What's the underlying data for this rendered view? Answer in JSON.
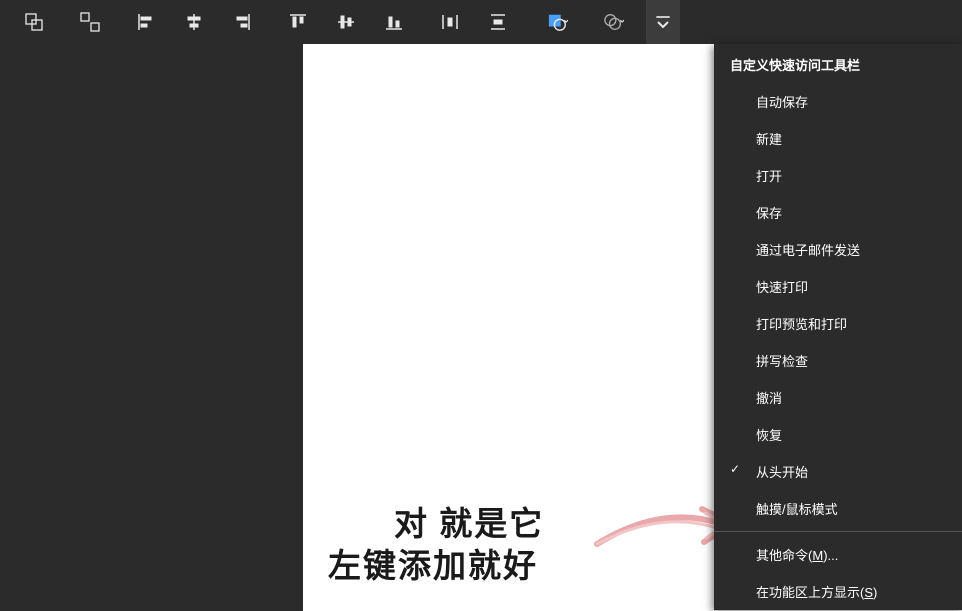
{
  "toolbar": {
    "icons": [
      "group-icon",
      "ungroup-icon",
      "align-left-icon",
      "align-center-h-icon",
      "align-right-icon",
      "align-top-icon",
      "align-middle-v-icon",
      "align-bottom-icon",
      "distribute-h-icon",
      "distribute-v-icon",
      "shape-fill-icon",
      "shape-outline-icon"
    ]
  },
  "dropdown": {
    "header": "自定义快速访问工具栏",
    "items": [
      {
        "label": "自动保存",
        "checked": false
      },
      {
        "label": "新建",
        "checked": false
      },
      {
        "label": "打开",
        "checked": false
      },
      {
        "label": "保存",
        "checked": false
      },
      {
        "label": "通过电子邮件发送",
        "checked": false
      },
      {
        "label": "快速打印",
        "checked": false
      },
      {
        "label": "打印预览和打印",
        "checked": false
      },
      {
        "label": "拼写检查",
        "checked": false
      },
      {
        "label": "撤消",
        "checked": false
      },
      {
        "label": "恢复",
        "checked": false
      },
      {
        "label": "从头开始",
        "checked": true
      },
      {
        "label": "触摸/鼠标模式",
        "checked": false
      }
    ],
    "moreCommands": {
      "prefix": "其他命令(",
      "key": "M",
      "suffix": ")..."
    },
    "showAbove": {
      "prefix": "在功能区上方显示(",
      "key": "S",
      "suffix": ")"
    }
  },
  "annotation": {
    "line1": "对 就是它",
    "line2": "左键添加就好"
  }
}
